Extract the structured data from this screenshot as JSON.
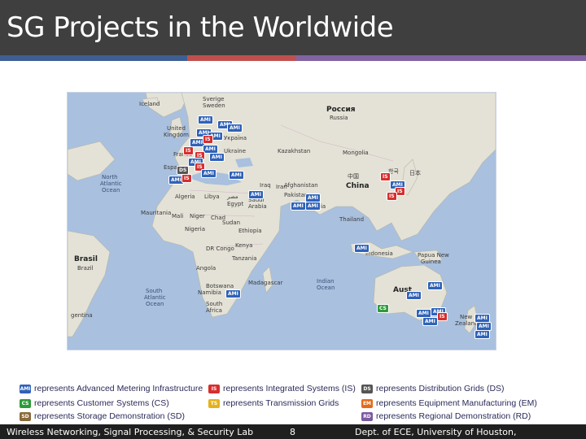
{
  "slide": {
    "title": "SG Projects in the Worldwide"
  },
  "colors": {
    "title_bg": "#3f3f3f",
    "stripe_blue": "#3e5f93",
    "stripe_red": "#c0504d",
    "stripe_purple": "#8064a2",
    "ocean": "#a9c0de",
    "land": "#e4e2d6",
    "ami_blue": "#2f62b8",
    "is_red": "#d62e2e",
    "cs_green": "#2e9a3a",
    "ts_yellow": "#e4b21a",
    "ds_dark": "#555555",
    "em_orange": "#e46b1a",
    "rd_purple": "#7a5aa0"
  },
  "map": {
    "labels": {
      "sweden": "Sverige",
      "sweden_en": "Sweden",
      "iceland": "Iceland",
      "ukraine_native": "Україна",
      "ukraine": "Ukraine",
      "russia_native": "Россия",
      "russia": "Russia",
      "uk_1": "United",
      "uk_2": "Kingdom",
      "france": "France",
      "spain": "Espa",
      "kazakhstan": "Kazakhstan",
      "mongolia": "Mongolia",
      "china_native": "中国",
      "china": "China",
      "korea": "한국",
      "japan": "日本",
      "north_atlantic_1": "North",
      "north_atlantic_2": "Atlantic",
      "north_atlantic_3": "Ocean",
      "algeria": "Algeria",
      "libya": "Libya",
      "egypt_native": "مصر",
      "egypt": "Egypt",
      "iraq": "Iraq",
      "iran": "Iran",
      "afghanistan": "Afghanistan",
      "pakistan": "Pakistan",
      "saudi_1": "Saudi",
      "saudi_2": "Arabia",
      "india": "India",
      "thailand": "Thailand",
      "mauritania": "Mauritania",
      "mali": "Mali",
      "niger": "Niger",
      "chad": "Chad",
      "sudan": "Sudan",
      "nigeria": "Nigeria",
      "ethiopia": "Ethiopia",
      "drc": "DR Congo",
      "kenya": "Kenya",
      "tanzania": "Tanzania",
      "angola": "Angola",
      "madagascar": "Madagascar",
      "botswana": "Botswana",
      "namibia": "Namibia",
      "south_africa_1": "South",
      "south_africa_2": "Africa",
      "brasil": "Brasil",
      "brazil": "Brazil",
      "argentina": "gentina",
      "south_atlantic_1": "South",
      "south_atlantic_2": "Atlantic",
      "south_atlantic_3": "Ocean",
      "indian_ocean_1": "Indian",
      "indian_ocean_2": "Ocean",
      "indonesia": "Indonesia",
      "png_1": "Papua New",
      "png_2": "Guinea",
      "australia": "Aust",
      "nz_1": "New",
      "nz_2": "Zealand"
    },
    "markers": {
      "ami": "AMI",
      "is": "IS",
      "ds": "DS",
      "cs": "CS"
    }
  },
  "legend": [
    {
      "badge": "AMI",
      "text": "represents Advanced Metering Infrastructure"
    },
    {
      "badge": "CS",
      "text": "represents Customer Systems (CS)"
    },
    {
      "badge": "SD",
      "text": "represents Storage Demonstration (SD)"
    },
    {
      "badge": "IS",
      "text": "represents Integrated Systems (IS)"
    },
    {
      "badge": "TS",
      "text": "represents Transmission   Grids"
    },
    {
      "badge": "DS",
      "text": "represents Distribution   Grids     (DS)"
    },
    {
      "badge": "EM",
      "text": "represents Equipment Manufacturing (EM)"
    },
    {
      "badge": "RD",
      "text": "represents Regional Demonstration (RD)"
    }
  ],
  "footer": {
    "lab": "Wireless Networking, Signal Processing, & Security Lab",
    "page": "8",
    "dept": "Dept. of ECE, University of Houston,"
  }
}
